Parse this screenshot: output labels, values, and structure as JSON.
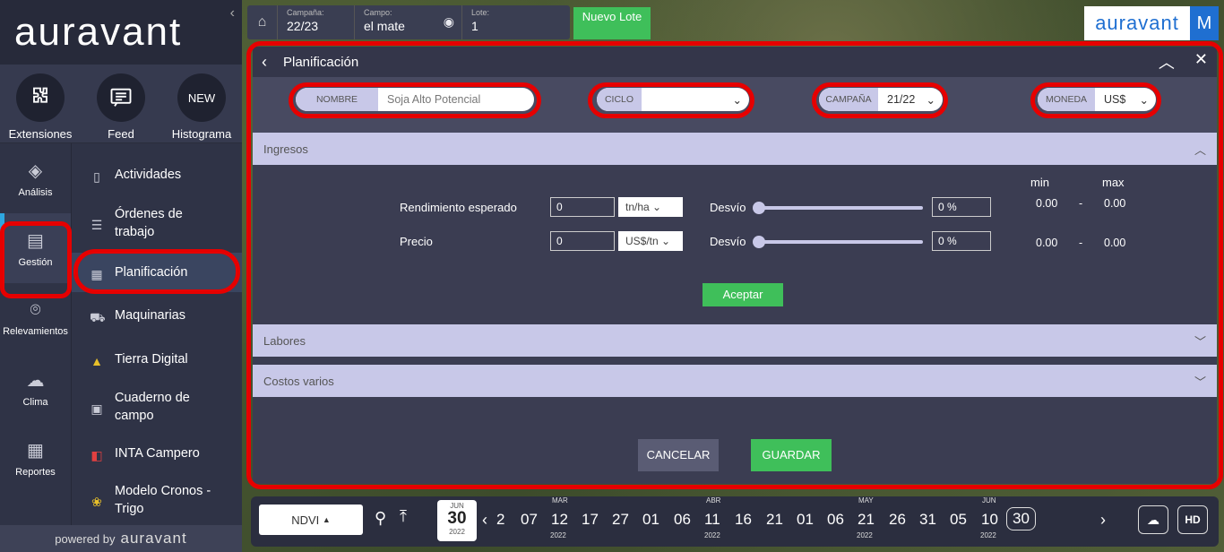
{
  "sidebar": {
    "logo": "auravant",
    "tools": [
      {
        "label": "Extensiones",
        "icon": "puzzle-icon"
      },
      {
        "label": "Feed",
        "icon": "chat-icon"
      },
      {
        "label": "Histograma",
        "icon": "new-badge",
        "badge": "NEW"
      }
    ],
    "rail": [
      {
        "label": "Análisis",
        "icon": "layers-icon"
      },
      {
        "label": "Gestión",
        "icon": "clipboard-icon"
      },
      {
        "label": "Relevamientos",
        "icon": "pin-icon"
      },
      {
        "label": "Clima",
        "icon": "cloud-icon"
      },
      {
        "label": "Reportes",
        "icon": "report-icon"
      }
    ],
    "menu": [
      {
        "label": "Actividades"
      },
      {
        "label": "Órdenes de trabajo"
      },
      {
        "label": "Planificación"
      },
      {
        "label": "Maquinarias"
      },
      {
        "label": "Tierra Digital"
      },
      {
        "label": "Cuaderno de campo"
      },
      {
        "label": "INTA Campero"
      },
      {
        "label": "Modelo Cronos - Trigo"
      }
    ],
    "powered_by": "powered by",
    "powered_brand": "auravant"
  },
  "topbar": {
    "campaign_caption": "Campaña:",
    "campaign_value": "22/23",
    "field_caption": "Campo:",
    "field_value": "el mate",
    "lot_caption": "Lote:",
    "lot_value": "1",
    "new_lot_label": "Nuevo Lote",
    "brand": "auravant",
    "user_initial": "M"
  },
  "dialog": {
    "title": "Planificación",
    "params": {
      "name_label": "NOMBRE",
      "name_value": "Soja Alto Potencial",
      "cycle_label": "CICLO",
      "cycle_value": "",
      "campaign_label": "CAMPAÑA",
      "campaign_value": "21/22",
      "currency_label": "MONEDA",
      "currency_value": "US$"
    },
    "ingresos": {
      "title": "Ingresos",
      "min_label": "min",
      "max_label": "max",
      "rows": [
        {
          "label": "Rendimiento esperado",
          "value": "0",
          "unit": "tn/ha",
          "desvio_label": "Desvío",
          "desvio_value": "0 %",
          "desvio": 0,
          "min": "0.00",
          "sep": "-",
          "max": "0.00"
        },
        {
          "label": "Precio",
          "value": "0",
          "unit": "US$/tn",
          "desvio_label": "Desvío",
          "desvio_value": "0 %",
          "desvio": 0,
          "min": "0.00",
          "sep": "-",
          "max": "0.00"
        }
      ],
      "accept_label": "Aceptar"
    },
    "labores_title": "Labores",
    "costos_title": "Costos varios",
    "cancel_label": "CANCELAR",
    "save_label": "GUARDAR"
  },
  "timeline": {
    "layer": "NDVI",
    "date_month": "JUN",
    "date_day": "30",
    "date_year": "2022",
    "months": [
      "MAR",
      "ABR",
      "MAY",
      "JUN"
    ],
    "years": [
      "2022",
      "2022",
      "2022",
      "2022"
    ],
    "days": [
      "2",
      "07",
      "12",
      "17",
      "27",
      "01",
      "06",
      "11",
      "16",
      "21",
      "01",
      "06",
      "21",
      "26",
      "31",
      "05",
      "10",
      "30"
    ],
    "hd_label": "HD"
  }
}
